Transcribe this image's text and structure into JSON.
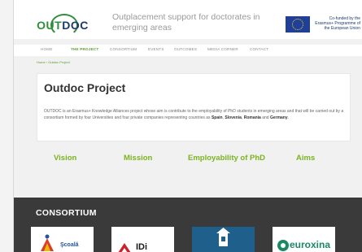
{
  "header": {
    "logo": {
      "prefix": "OUT",
      "suffix": "DOC"
    },
    "tagline": "Outplacement support for doctorates in emerging areas",
    "eu_notice": "Co-funded by the Erasmus+ Programme of the European Union"
  },
  "nav": {
    "items": [
      "HOME",
      "THE PROJECT",
      "CONSORTIUM",
      "EVENTS",
      "OUTCOMES",
      "MEDIA CORNER",
      "CONTACT"
    ],
    "active": "THE PROJECT"
  },
  "breadcrumb": "Home › Outdoc Project",
  "project": {
    "title": "Outdoc Project",
    "text_before": "OUTDOC is an Erasmus+ Knowledge Alliances project whose aim is contribute to the employability of PhD students in emerging areas and that will be carried out by a consortium formed by four Universities and four private companies representing countries as ",
    "country_1": "Spain",
    "sep_1": ", ",
    "country_2": "Slovenia",
    "sep_2": ", ",
    "country_3": "Romania",
    "sep_3": " and ",
    "country_4": "Germany",
    "text_after": "."
  },
  "pillars": [
    "Vision",
    "Mission",
    "Employability of PhD",
    "Aims"
  ],
  "consortium": {
    "title": "CONSORTIUM",
    "partners": [
      "Şcoală",
      "IDi",
      "",
      "euroxina"
    ]
  },
  "colors": {
    "accent_green": "#7ab31f",
    "nav_active": "#5a9e2f",
    "dark_band": "#3a3a3a",
    "eu_blue": "#1f3f99"
  }
}
